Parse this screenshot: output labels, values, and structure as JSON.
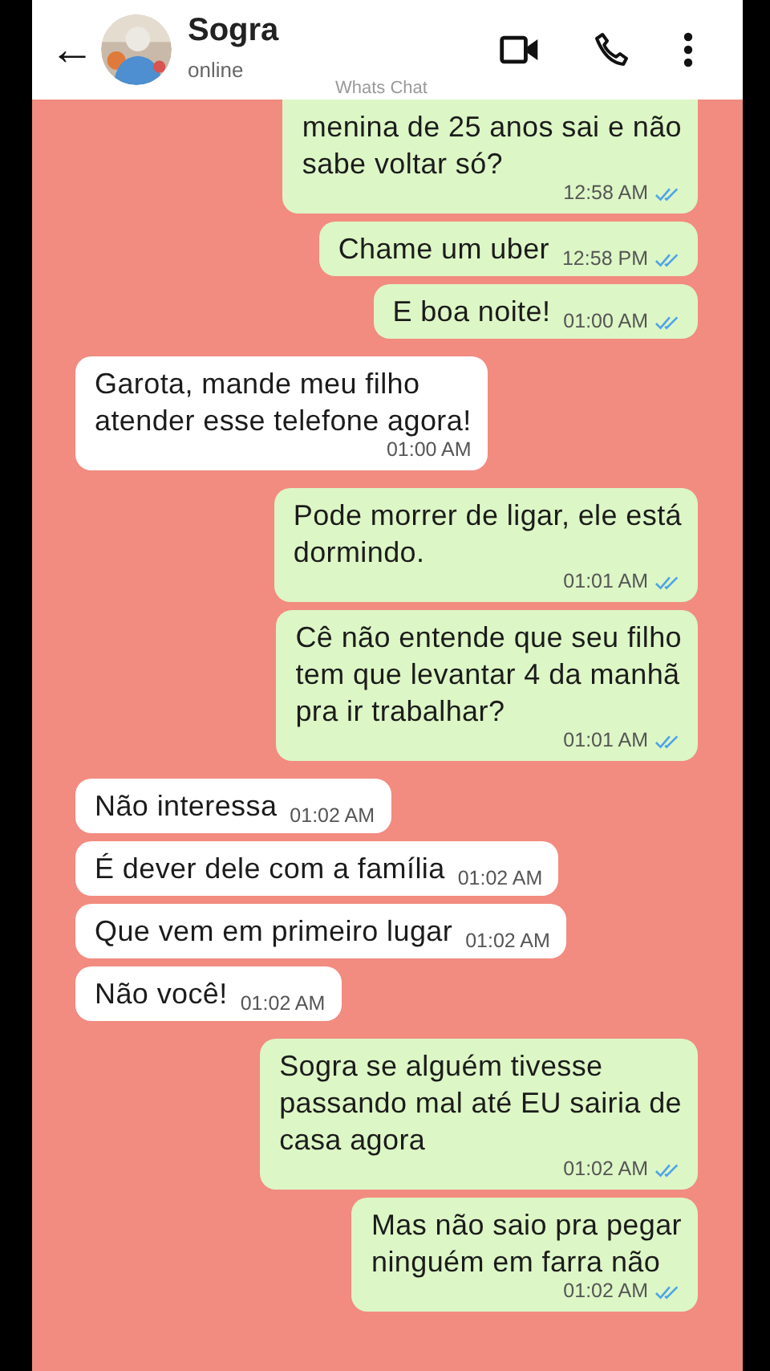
{
  "header": {
    "back": "←",
    "contact_name": "Sogra",
    "status": "online",
    "watermark_label": "Whats Chat"
  },
  "messages": [
    {
      "kind": "sent",
      "text": "menina de 25 anos sai e não\nsabe voltar só?",
      "time": "12:58 AM",
      "read": true
    },
    {
      "kind": "sent",
      "text": "Chame um uber",
      "time": "12:58 PM",
      "read": true
    },
    {
      "kind": "sent",
      "text": "E boa noite!",
      "time": "01:00 AM",
      "read": true
    },
    {
      "kind": "received",
      "text": "Garota, mande meu filho\natender esse telefone agora!",
      "time": "01:00 AM"
    },
    {
      "kind": "sent",
      "text": "Pode morrer de ligar, ele está\ndormindo.",
      "time": "01:01 AM",
      "read": true
    },
    {
      "kind": "sent",
      "text": "Cê não entende que seu filho\ntem que levantar 4 da manhã\npra ir trabalhar?",
      "time": "01:01 AM",
      "read": true
    },
    {
      "kind": "received",
      "text": "Não interessa",
      "time": "01:02 AM"
    },
    {
      "kind": "received",
      "text": "É dever dele com a família",
      "time": "01:02 AM"
    },
    {
      "kind": "received",
      "text": "Que vem em primeiro lugar",
      "time": "01:02 AM"
    },
    {
      "kind": "received",
      "text": "Não você!",
      "time": "01:02 AM"
    },
    {
      "kind": "sent",
      "text": "Sogra se alguém tivesse\npassando mal até EU sairia de\ncasa agora",
      "time": "01:02 AM",
      "read": true
    },
    {
      "kind": "sent",
      "text": "Mas não saio pra pegar\nninguém em farra não",
      "time": "01:02 AM",
      "read": true
    }
  ]
}
